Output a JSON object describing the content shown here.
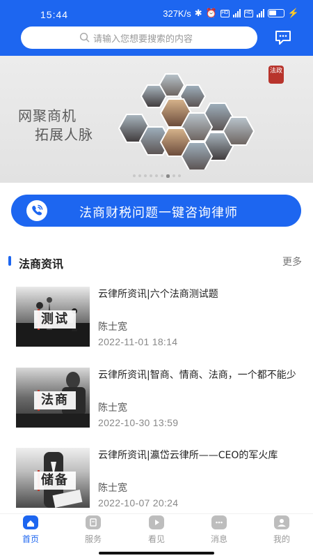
{
  "status_bar": {
    "time": "15:44",
    "speed": "327K/s"
  },
  "search": {
    "placeholder": "请输入您想要搜索的内容"
  },
  "banner": {
    "line1": "网聚商机",
    "line2": "拓展人脉",
    "seal_text": "法政",
    "slide_count": 9,
    "active_slide": 7
  },
  "consult_button": {
    "label": "法商财税问题一键咨询律师"
  },
  "section": {
    "title": "法商资讯",
    "more": "更多"
  },
  "news": [
    {
      "title": "云律所资讯|六个法商测试题",
      "author": "陈士宽",
      "date": "2022-11-01 18:14",
      "thumb_text": "测试"
    },
    {
      "title": "云律所资讯|智商、情商、法商，一个都不能少",
      "author": "陈士宽",
      "date": "2022-10-30 13:59",
      "thumb_text": "法商"
    },
    {
      "title": "云律所资讯|瀛岱云律所——CEO的军火库",
      "author": "陈士宽",
      "date": "2022-10-07 20:24",
      "thumb_text": "储备"
    }
  ],
  "tabs": [
    {
      "label": "首页",
      "icon": "home-icon",
      "active": true
    },
    {
      "label": "服务",
      "icon": "service-icon",
      "active": false
    },
    {
      "label": "看见",
      "icon": "play-icon",
      "active": false
    },
    {
      "label": "消息",
      "icon": "message-icon",
      "active": false
    },
    {
      "label": "我的",
      "icon": "profile-icon",
      "active": false
    }
  ],
  "colors": {
    "brand_blue": "#1d66f0",
    "text_dark": "#222222",
    "text_grey": "#888888"
  }
}
